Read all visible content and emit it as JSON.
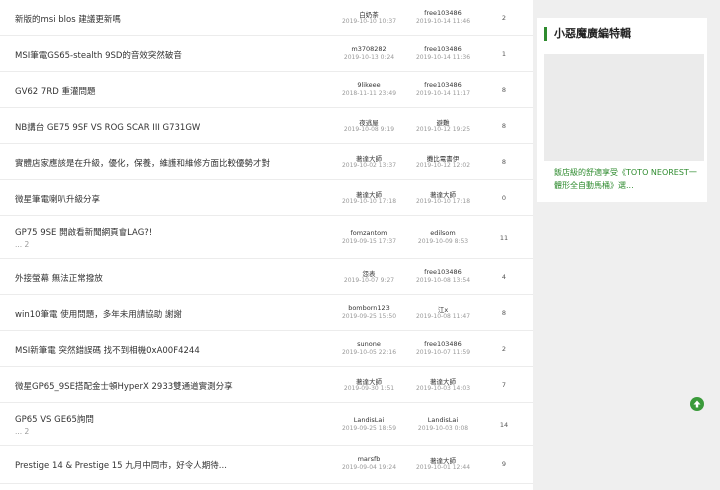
{
  "threads": [
    {
      "title": "新版的msi blos 建議更新嗎",
      "poster": "白奶茶",
      "post_time": "2019-10-10 10:37",
      "replier": "free103486",
      "reply_time": "2019-10-14 11:46",
      "replies": "2"
    },
    {
      "title": "MSI筆電GS65-stealth 9SD的音效突然破音",
      "poster": "m3708282",
      "post_time": "2019-10-13 0:24",
      "replier": "free103486",
      "reply_time": "2019-10-14 11:36",
      "replies": "1"
    },
    {
      "title": "GV62 7RD 重灌問題",
      "poster": "9likeee",
      "post_time": "2018-11-11 23:49",
      "replier": "free103486",
      "reply_time": "2019-10-14 11:17",
      "replies": "8"
    },
    {
      "title": "NB講台 GE75 9SF VS ROG SCAR III G731GW",
      "poster": "夜逃屋",
      "post_time": "2019-10-08 9:19",
      "replier": "避難",
      "reply_time": "2019-10-12 19:25",
      "replies": "8"
    },
    {
      "title": "實體店家應該是在升級，優化，保養，維護和維修方面比較優勢才對",
      "poster": "著達大師",
      "post_time": "2019-10-02 13:37",
      "replier": "攤比電書伊",
      "reply_time": "2019-10-12 12:02",
      "replies": "8"
    },
    {
      "title": "微星筆電喇叭升級分享",
      "poster": "著達大師",
      "post_time": "2019-10-10 17:18",
      "replier": "著達大師",
      "reply_time": "2019-10-10 17:18",
      "replies": "0"
    },
    {
      "title": "GP75 9SE 開啟看新聞網頁會LAG?!",
      "pages": "... 2",
      "poster": "fomzantom",
      "post_time": "2019-09-15 17:37",
      "replier": "edilsom",
      "reply_time": "2019-10-09 8:53",
      "replies": "11"
    },
    {
      "title": "外接螢幕 無法正常撥放",
      "poster": "怨表",
      "post_time": "2019-10-07 9:27",
      "replier": "free103486",
      "reply_time": "2019-10-08 13:54",
      "replies": "4"
    },
    {
      "title": "win10筆電 使用問題，多年未用請協助 謝謝",
      "poster": "bomborn123",
      "post_time": "2019-09-25 15:50",
      "replier": "江x",
      "reply_time": "2019-10-08 11:47",
      "replies": "8"
    },
    {
      "title": "MSI新筆電 突然錯誤碼 找不到相機0xA00F4244",
      "poster": "sunone",
      "post_time": "2019-10-05 22:16",
      "replier": "free103486",
      "reply_time": "2019-10-07 11:59",
      "replies": "2"
    },
    {
      "title": "微星GP65_9SE搭配金士頓HyperX 2933雙通道實測分享",
      "poster": "著達大師",
      "post_time": "2019-09-30 1:51",
      "replier": "著達大師",
      "reply_time": "2019-10-03 14:03",
      "replies": "7"
    },
    {
      "title": "GP65 VS GE65詢問",
      "pages": "... 2",
      "poster": "LandisLai",
      "post_time": "2019-09-25 18:59",
      "replier": "LandisLai",
      "reply_time": "2019-10-03 0:08",
      "replies": "14"
    },
    {
      "title": "Prestige 14 & Prestige 15 九月中問市，好令人期待...",
      "poster": "marsfb",
      "post_time": "2019-09-04 19:24",
      "replier": "著達大師",
      "reply_time": "2019-10-01 12:44",
      "replies": "9"
    }
  ],
  "sidebar": {
    "title": "小惡魔廣編特輯",
    "ad_text": "飯店級的舒適享受《TOTO NEOREST一體形全自動馬桶》選..."
  },
  "back_to_top_icon": "arrow-up-icon",
  "colors": {
    "accent": "#2e8b2e",
    "button": "#3a9a3a"
  }
}
